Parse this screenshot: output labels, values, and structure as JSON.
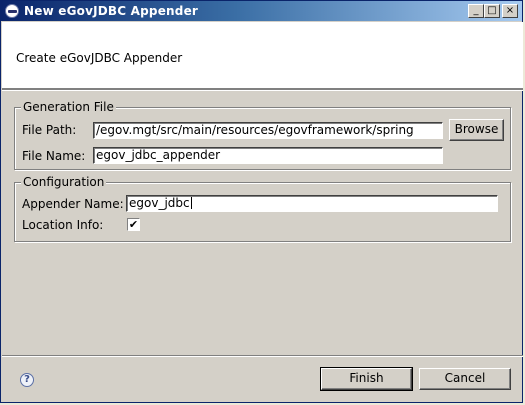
{
  "window": {
    "title": "New eGovJDBC Appender",
    "controls": {
      "minimize": "_",
      "maximize": "□",
      "close": "×"
    }
  },
  "header": {
    "message": "Create eGovJDBC Appender"
  },
  "generation_file": {
    "legend": "Generation File",
    "file_path_label": "File Path:",
    "file_path_value": "/egov.mgt/src/main/resources/egovframework/spring",
    "browse_label": "Browse",
    "file_name_label": "File Name:",
    "file_name_value": "egov_jdbc_appender"
  },
  "configuration": {
    "legend": "Configuration",
    "appender_name_label": "Appender Name:",
    "appender_name_value": "egov_jdbc",
    "location_info_label": "Location Info:",
    "location_info_checked": true,
    "check_glyph": "✔"
  },
  "footer": {
    "help_glyph": "?",
    "finish_label": "Finish",
    "cancel_label": "Cancel"
  }
}
